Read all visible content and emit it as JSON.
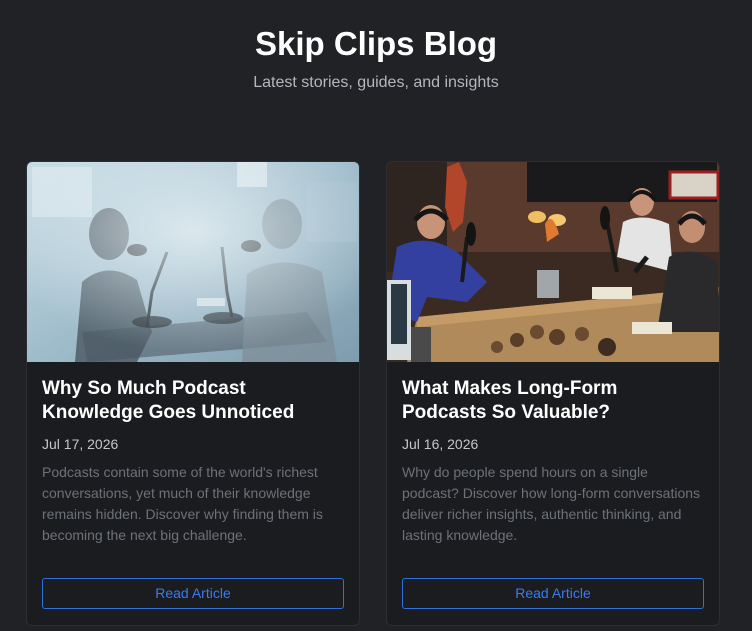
{
  "header": {
    "title": "Skip Clips Blog",
    "subtitle": "Latest stories, guides, and insights"
  },
  "articles": [
    {
      "title": "Why So Much Podcast Knowledge Goes Unnoticed",
      "date": "Jul 17, 2026",
      "excerpt": "Podcasts contain some of the world's richest conversations, yet much of their knowledge remains hidden. Discover why finding them is becoming the next big challenge.",
      "button_label": "Read Article"
    },
    {
      "title": "What Makes Long-Form Podcasts So Valuable?",
      "date": "Jul 16, 2026",
      "excerpt": "Why do people spend hours on a single podcast? Discover how long-form conversations deliver richer insights, authentic thinking, and lasting knowledge.",
      "button_label": "Read Article"
    }
  ],
  "colors": {
    "background": "#202226",
    "card": "#1b1c1f",
    "accent": "#3a7bf0",
    "muted_text": "#6d7178"
  }
}
